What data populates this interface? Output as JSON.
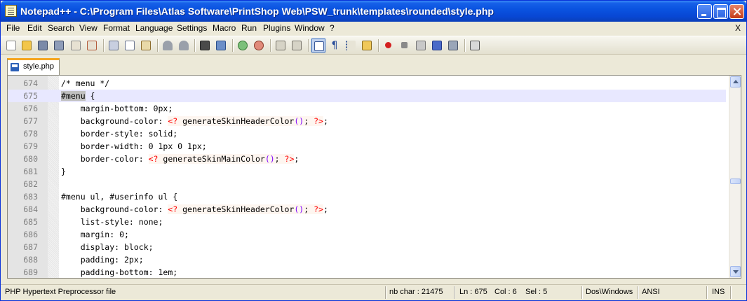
{
  "window": {
    "title": "Notepad++ - C:\\Program Files\\Atlas Software\\PrintShop Web\\PSW_trunk\\templates\\rounded\\style.php"
  },
  "menu": {
    "items": [
      "File",
      "Edit",
      "Search",
      "View",
      "Format",
      "Language",
      "Settings",
      "Macro",
      "Run",
      "Plugins",
      "Window",
      "?"
    ],
    "close_label": "X"
  },
  "toolbar": {
    "icons": [
      "new-file-icon",
      "open-file-icon",
      "save-icon",
      "save-all-icon",
      "close-icon",
      "close-all-icon",
      "cut-icon",
      "copy-icon",
      "paste-icon",
      "undo-icon",
      "redo-icon",
      "find-icon",
      "replace-icon",
      "zoom-in-icon",
      "zoom-out-icon",
      "sync-vertical-icon",
      "sync-horizontal-icon",
      "word-wrap-icon",
      "show-all-chars-icon",
      "indent-guide-icon",
      "user-define-icon",
      "record-macro-icon",
      "stop-record-icon",
      "play-macro-icon",
      "run-macro-multiple-icon",
      "save-macro-icon",
      "print-icon"
    ],
    "pressed": "word-wrap-icon"
  },
  "tabs": [
    {
      "label": "style.php"
    }
  ],
  "editor": {
    "lines": [
      {
        "n": "674",
        "text": "/* menu */"
      },
      {
        "n": "675",
        "sel": "#menu",
        "text": " {",
        "current": true
      },
      {
        "n": "676",
        "text": "    margin-bottom: 0px;"
      },
      {
        "n": "677",
        "pre": "    background-color: ",
        "fn": " generateSkinHeaderColor",
        "post": ";"
      },
      {
        "n": "678",
        "text": "    border-style: solid;"
      },
      {
        "n": "679",
        "text": "    border-width: 0 1px 0 1px;"
      },
      {
        "n": "680",
        "pre": "    border-color: ",
        "fn": " generateSkinMainColor",
        "post": ";"
      },
      {
        "n": "681",
        "text": "}"
      },
      {
        "n": "682",
        "text": ""
      },
      {
        "n": "683",
        "text": "#menu ul, #userinfo ul {"
      },
      {
        "n": "684",
        "pre": "    background-color: ",
        "fn": " generateSkinHeaderColor",
        "post": ";"
      },
      {
        "n": "685",
        "text": "    list-style: none;"
      },
      {
        "n": "686",
        "text": "    margin: 0;"
      },
      {
        "n": "687",
        "text": "    display: block;"
      },
      {
        "n": "688",
        "text": "    padding: 2px;"
      },
      {
        "n": "689",
        "text": "    padding-bottom: 1em;"
      }
    ],
    "php_open": "<?",
    "php_close": "?>",
    "php_parens": "()",
    "php_semi": ";"
  },
  "status": {
    "file_type": "PHP Hypertext Preprocessor file",
    "nb_char": "nb char : 21475",
    "ln": "Ln : 675",
    "col": "Col : 6",
    "sel": "Sel : 5",
    "eol": "Dos\\Windows",
    "encoding": "ANSI",
    "mode": "INS"
  }
}
